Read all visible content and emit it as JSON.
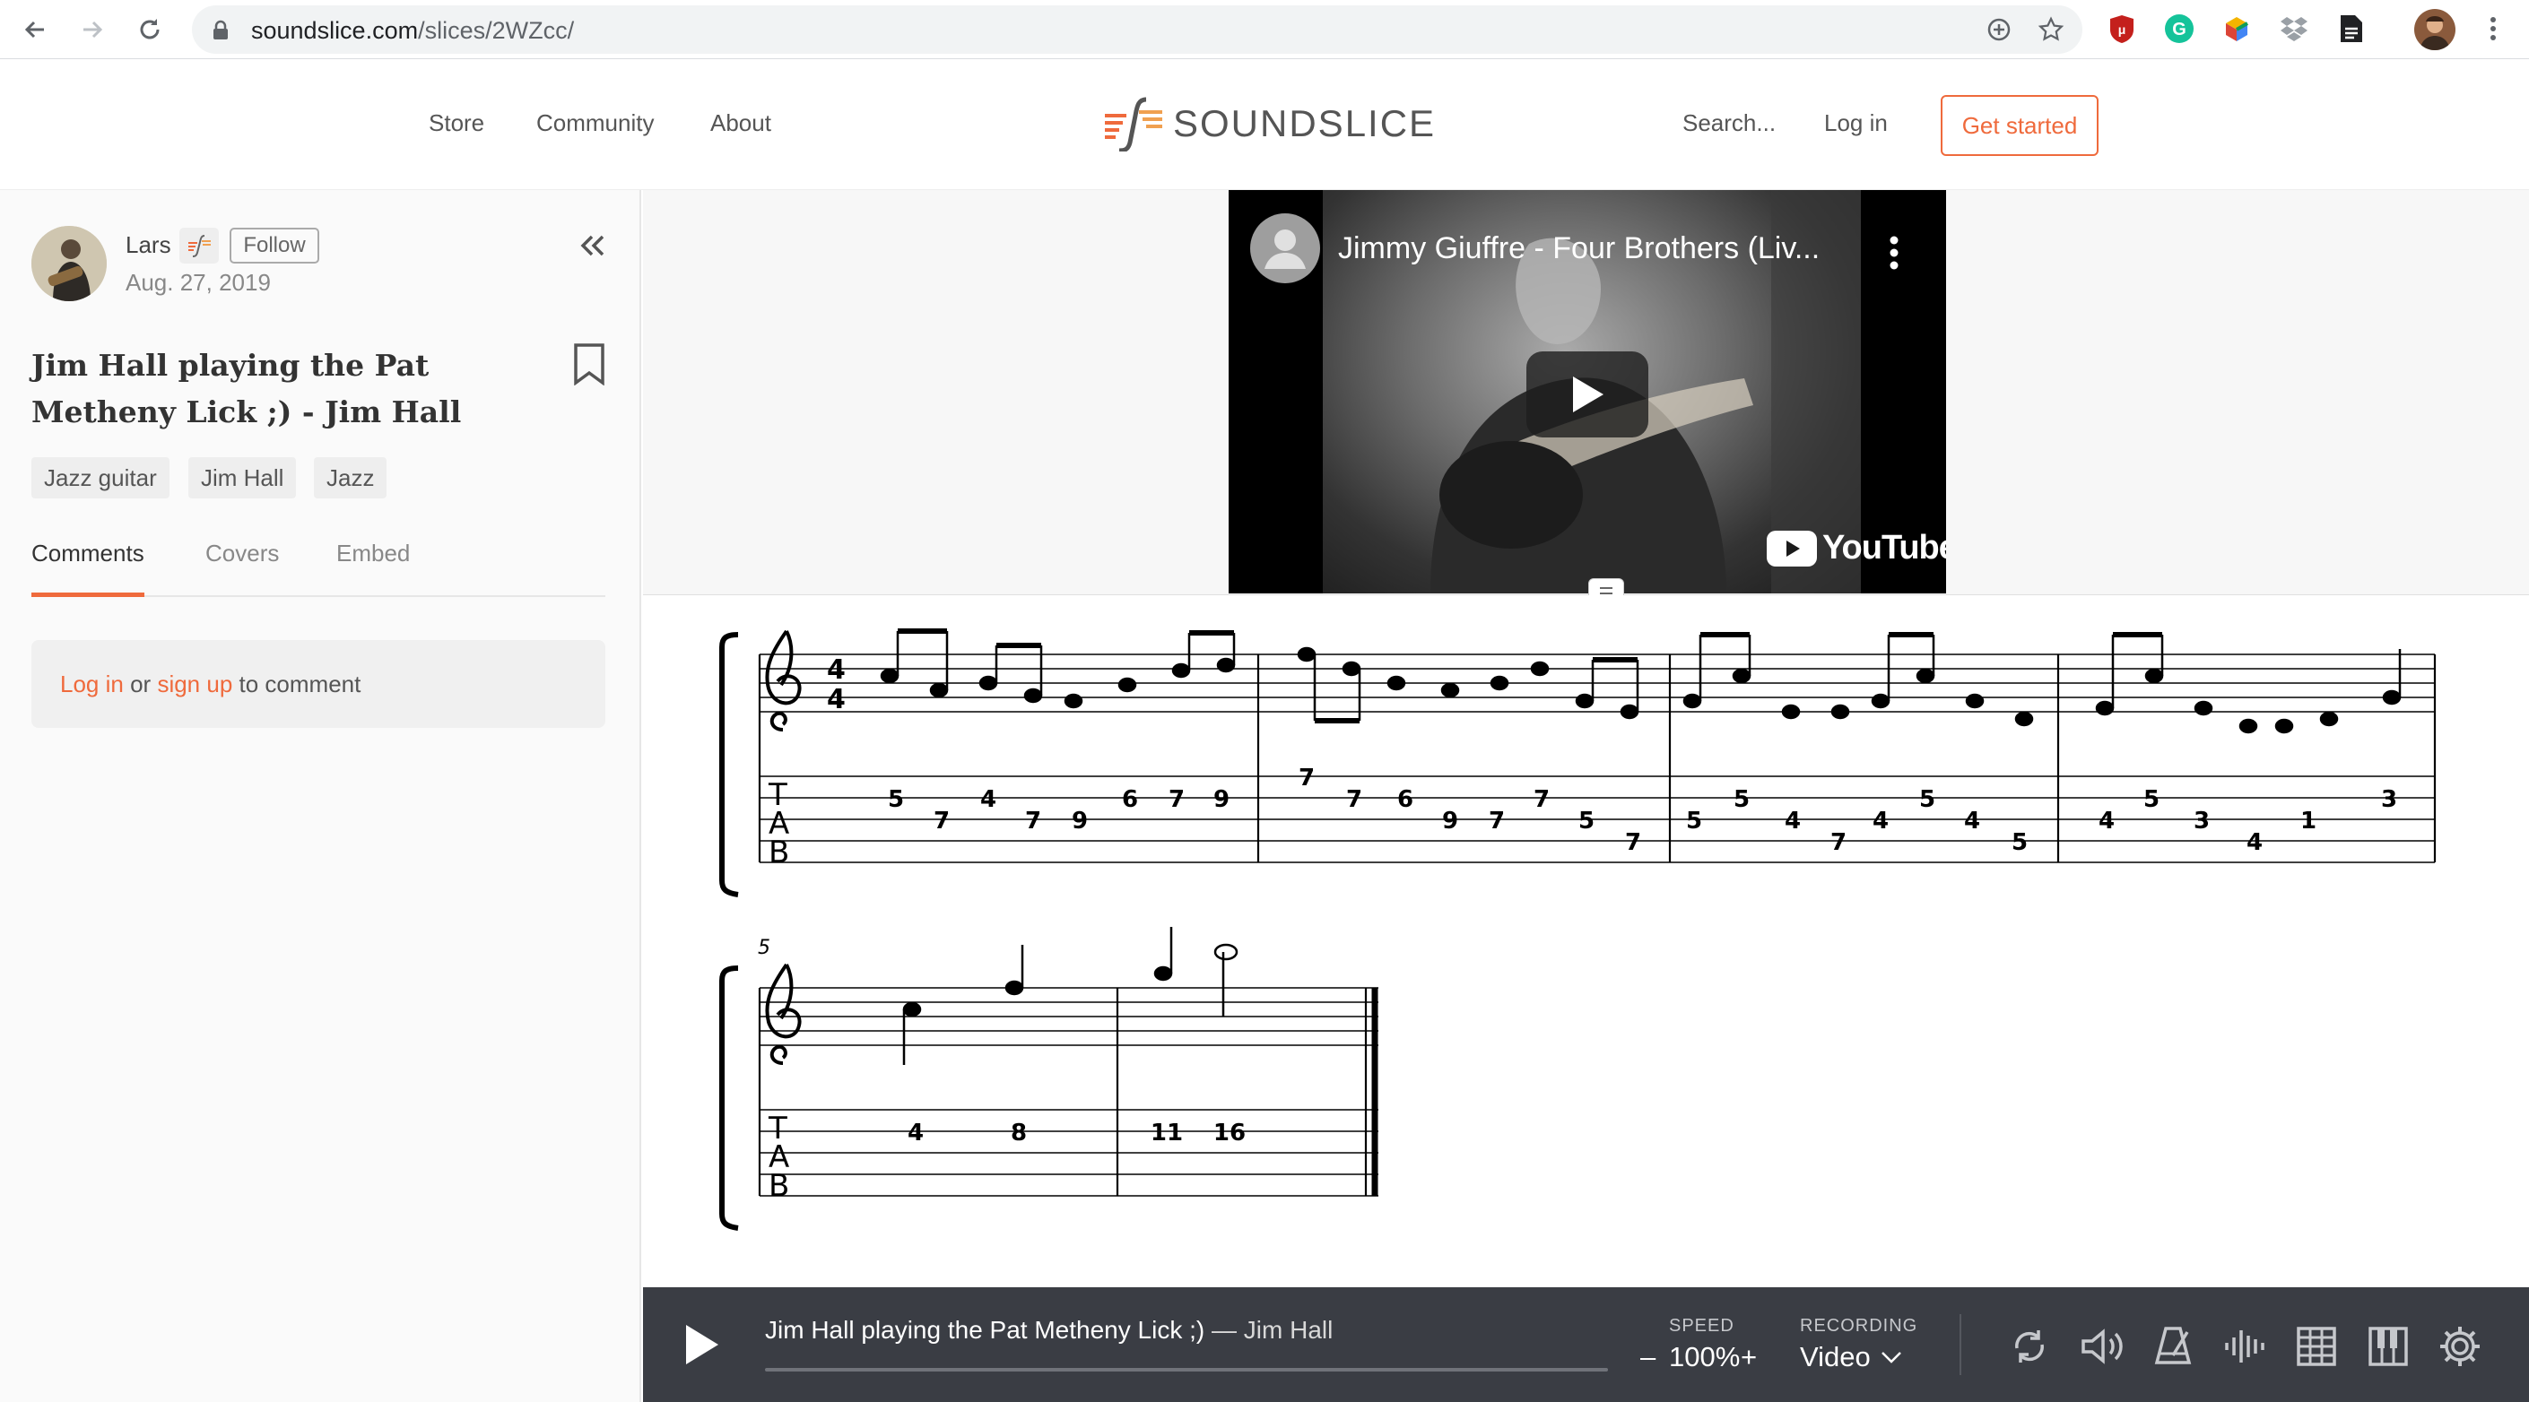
{
  "browser": {
    "url_host": "soundslice.com",
    "url_path": "/slices/2WZcc/"
  },
  "site": {
    "nav": [
      "Store",
      "Community",
      "About"
    ],
    "logo_text": "SOUNDSLICE",
    "search_label": "Search...",
    "login_label": "Log in",
    "get_started_label": "Get started",
    "accent_color": "#ef6a3c"
  },
  "sidebar": {
    "author": "Lars",
    "follow_label": "Follow",
    "date": "Aug. 27, 2019",
    "title": "Jim Hall playing the Pat Metheny Lick ;) - Jim Hall",
    "tags": [
      "Jazz guitar",
      "Jim Hall",
      "Jazz"
    ],
    "tabs": [
      "Comments",
      "Covers",
      "Embed"
    ],
    "active_tab": "Comments",
    "comment_prompt": {
      "login": "Log in",
      "or": "or",
      "signup": "sign up",
      "rest": "to comment"
    }
  },
  "video": {
    "title": "Jimmy Giuffre - Four Brothers (Liv...",
    "brand": "YouTube"
  },
  "score": {
    "measure_number_2": "5",
    "tab_letters": [
      "T",
      "A",
      "B"
    ],
    "row1_tab_numbers": [
      "5",
      "7",
      "4",
      "7",
      "9",
      "6",
      "7",
      "9",
      "7",
      "7",
      "6",
      "9",
      "7",
      "7",
      "5",
      "7",
      "5",
      "5",
      "4",
      "7",
      "4",
      "5",
      "4",
      "5",
      "4",
      "5",
      "3",
      "4",
      "1",
      "3"
    ],
    "row2_tab_numbers": [
      "4",
      "8",
      "11",
      "16"
    ]
  },
  "player": {
    "title": "Jim Hall playing the Pat Metheny Lick ;)",
    "separator": " — ",
    "artist": "Jim Hall",
    "speed_label": "SPEED",
    "speed_minus": "–",
    "speed_value": "100%",
    "speed_plus": "+",
    "recording_label": "RECORDING",
    "recording_value": "Video",
    "progress": 0.0
  }
}
